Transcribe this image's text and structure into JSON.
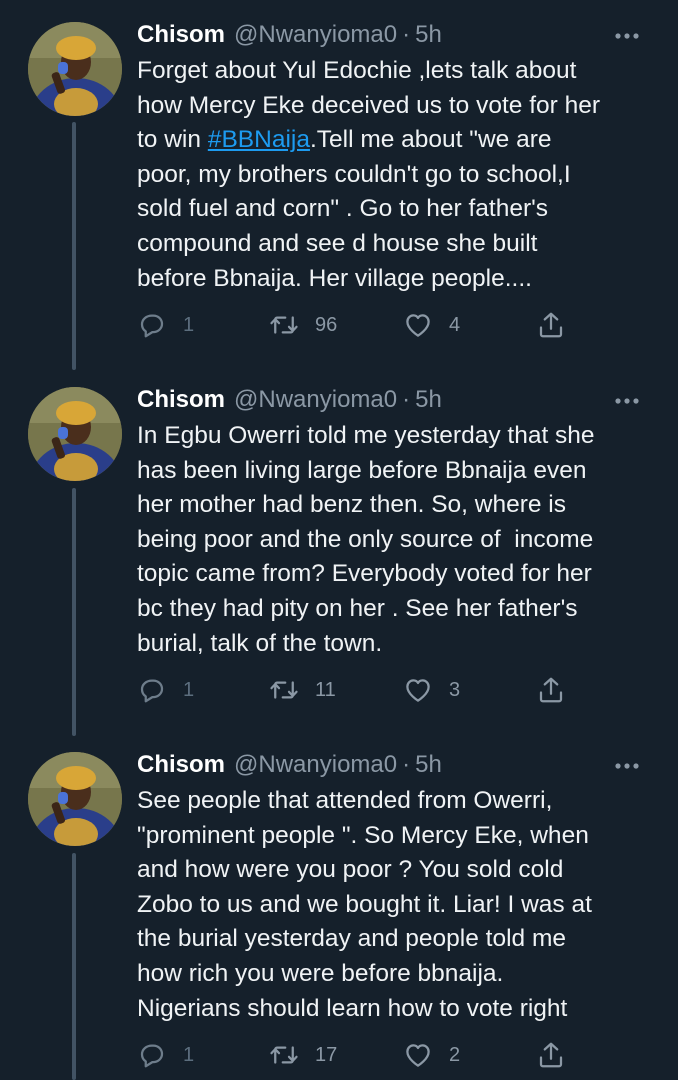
{
  "colors": {
    "background": "#15202b",
    "text": "#f0f3f5",
    "secondary": "#8b98a5",
    "link": "#1d9bf0",
    "thread_line": "#425364"
  },
  "tweets": [
    {
      "author": {
        "name": "Chisom",
        "handle": "@Nwanyioma0",
        "separator": "·",
        "time": "5h"
      },
      "lines": [
        "Forget about Yul Edochie ,lets talk about",
        "how Mercy Eke deceived us to vote for her",
        {
          "pre": "to win ",
          "hashtag": "#BBNaija",
          "post": ".Tell me about \"we are"
        },
        "poor, my brothers couldn't go to school,I",
        "sold fuel and corn\" . Go to her father's",
        "compound and see d house she built",
        "before Bbnaija. Her village people...."
      ],
      "metrics": {
        "replies": "1",
        "retweets": "96",
        "likes": "4"
      }
    },
    {
      "author": {
        "name": "Chisom",
        "handle": "@Nwanyioma0",
        "separator": "·",
        "time": "5h"
      },
      "lines": [
        "In Egbu Owerri told me yesterday that she",
        "has been living large before Bbnaija even",
        "her mother had benz then. So, where is",
        "being poor and the only source of  income",
        "topic came from? Everybody voted for her",
        "bc they had pity on her . See her father's",
        "burial, talk of the town."
      ],
      "metrics": {
        "replies": "1",
        "retweets": "11",
        "likes": "3"
      }
    },
    {
      "author": {
        "name": "Chisom",
        "handle": "@Nwanyioma0",
        "separator": "·",
        "time": "5h"
      },
      "lines": [
        "See people that attended from Owerri,",
        "\"prominent people \". So Mercy Eke, when",
        "and how were you poor ? You sold cold",
        "Zobo to us and we bought it. Liar! I was at",
        "the burial yesterday and people told me",
        "how rich you were before bbnaija.",
        "Nigerians should learn how to vote right"
      ],
      "metrics": {
        "replies": "1",
        "retweets": "17",
        "likes": "2"
      }
    }
  ],
  "icons": {
    "more": "more-dots-icon",
    "reply": "reply-bubble-icon",
    "retweet": "retweet-arrows-icon",
    "like": "heart-icon",
    "share": "share-upload-icon"
  }
}
